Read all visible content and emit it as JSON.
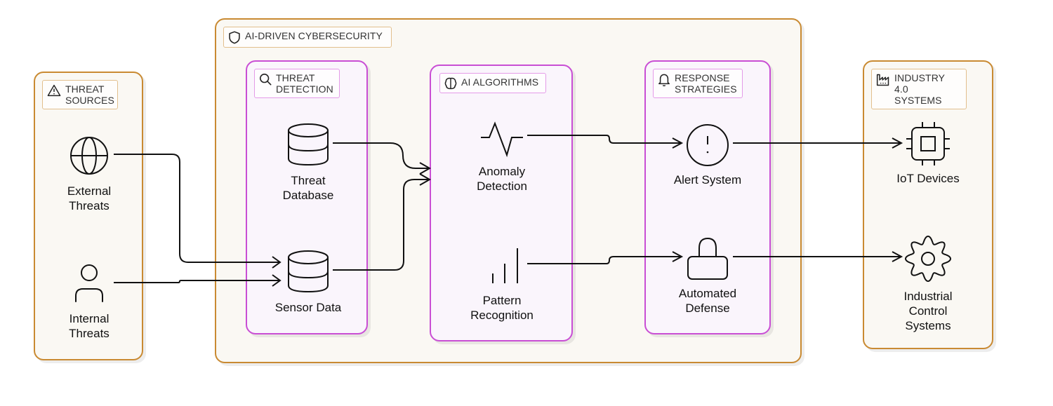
{
  "colors": {
    "outer_border": "#c98a32",
    "inner_border": "#c94ed4",
    "outer_fill": "#faf8f3",
    "inner_fill": "#faf5fc",
    "edge": "#111111"
  },
  "groups": {
    "threat_sources": {
      "title": "THREAT\nSOURCES",
      "icon": "warning-triangle-icon"
    },
    "ai_cybersecurity": {
      "title": "AI-DRIVEN CYBERSECURITY",
      "icon": "shield-icon"
    },
    "threat_detection": {
      "title": "THREAT\nDETECTION",
      "icon": "search-icon"
    },
    "ai_algorithms": {
      "title": "AI ALGORITHMS",
      "icon": "brain-icon"
    },
    "response_strategies": {
      "title": "RESPONSE\nSTRATEGIES",
      "icon": "bell-icon"
    },
    "industry_systems": {
      "title": "INDUSTRY 4.0\nSYSTEMS",
      "icon": "factory-icon"
    }
  },
  "nodes": {
    "external_threats": {
      "label": "External\nThreats",
      "icon": "globe-icon"
    },
    "internal_threats": {
      "label": "Internal\nThreats",
      "icon": "user-icon"
    },
    "threat_database": {
      "label": "Threat\nDatabase",
      "icon": "database-icon"
    },
    "sensor_data": {
      "label": "Sensor Data",
      "icon": "database-icon"
    },
    "anomaly_detection": {
      "label": "Anomaly\nDetection",
      "icon": "pulse-icon"
    },
    "pattern_recognition": {
      "label": "Pattern\nRecognition",
      "icon": "bar-chart-icon"
    },
    "alert_system": {
      "label": "Alert System",
      "icon": "alert-circle-icon"
    },
    "automated_defense": {
      "label": "Automated\nDefense",
      "icon": "lock-icon"
    },
    "iot_devices": {
      "label": "IoT Devices",
      "icon": "cpu-chip-icon"
    },
    "industrial_control": {
      "label": "Industrial\nControl\nSystems",
      "icon": "gear-icon"
    }
  },
  "edges": [
    {
      "from": "External Threats",
      "to": "Sensor Data"
    },
    {
      "from": "Internal Threats",
      "to": "Sensor Data"
    },
    {
      "from": "Threat Database",
      "to": "Anomaly Detection"
    },
    {
      "from": "Sensor Data",
      "to": "Anomaly Detection"
    },
    {
      "from": "Anomaly Detection",
      "to": "Alert System"
    },
    {
      "from": "Pattern Recognition",
      "to": "Automated Defense"
    },
    {
      "from": "Alert System",
      "to": "IoT Devices"
    },
    {
      "from": "Automated Defense",
      "to": "Industrial Control Systems"
    }
  ]
}
